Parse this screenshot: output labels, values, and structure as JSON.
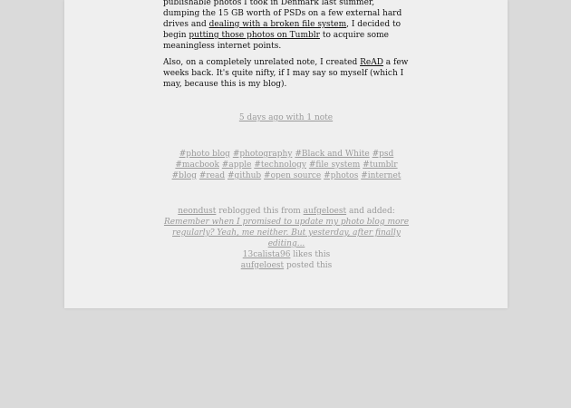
{
  "post": {
    "p1": {
      "t1": "publishable photos I took in Denmark last summer, dumping the 15 GB worth of PSDs on a few external hard drives and ",
      "link1": "dealing with a broken file system",
      "t2": ", I decided to begin ",
      "link2": "putting those photos on Tumblr",
      "t3": " to acquire some meaningless internet points."
    },
    "p2": {
      "t1": "Also, on a completely unrelated note, I created ",
      "link1": "ReAD",
      "t2": " a few weeks back. It's quite nifty, if I may say so myself (which I may, because this is my blog)."
    }
  },
  "meta": {
    "link": "5 days ago with 1 note"
  },
  "tags": [
    "#photo blog",
    "#photography",
    "#Black and White",
    "#psd",
    "#macbook",
    "#apple",
    "#technology",
    "#file system",
    "#tumblr",
    "#blog",
    "#read",
    "#github",
    "#open source",
    "#photos",
    "#internet"
  ],
  "notes": {
    "reblog": {
      "user": "neondust",
      "text1": " reblogged this from ",
      "source": "aufgeloest",
      "text2": " and added:"
    },
    "quote": "Remember when I promised to update my photo blog more regularly? Yeah, me neither. But yesterday, after finally editing...",
    "like": {
      "user": "13calista96",
      "text": " likes this"
    },
    "post": {
      "user": "aufgeloest",
      "text": " posted this"
    }
  }
}
